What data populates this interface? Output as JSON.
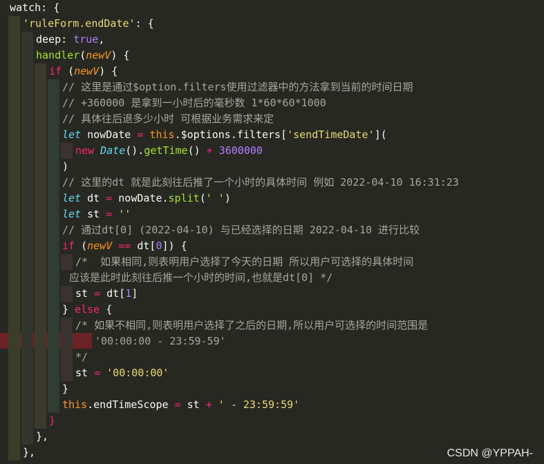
{
  "lines": [
    {
      "indent": 0,
      "tokens": [
        {
          "t": "watch",
          "c": "plain"
        },
        {
          "t": ": ",
          "c": "plain"
        },
        {
          "t": "{",
          "c": "punc"
        }
      ]
    },
    {
      "indent": 1,
      "tokens": [
        {
          "t": "'ruleForm.endDate'",
          "c": "str"
        },
        {
          "t": ": {",
          "c": "plain"
        }
      ]
    },
    {
      "indent": 2,
      "tokens": [
        {
          "t": "deep",
          "c": "plain"
        },
        {
          "t": ": ",
          "c": "plain"
        },
        {
          "t": "true",
          "c": "bool"
        },
        {
          "t": ",",
          "c": "plain"
        }
      ]
    },
    {
      "indent": 2,
      "tokens": [
        {
          "t": "handler",
          "c": "fn"
        },
        {
          "t": "(",
          "c": "plain"
        },
        {
          "t": "newV",
          "c": "param"
        },
        {
          "t": ") {",
          "c": "plain"
        }
      ]
    },
    {
      "indent": 3,
      "tokens": [
        {
          "t": "if",
          "c": "kw"
        },
        {
          "t": " (",
          "c": "plain"
        },
        {
          "t": "newV",
          "c": "param"
        },
        {
          "t": ") {",
          "c": "plain"
        }
      ]
    },
    {
      "indent": 4,
      "tokens": [
        {
          "t": "// 这里是通过$option.filters使用过滤器中的方法拿到当前的时间日期",
          "c": "cmt"
        }
      ]
    },
    {
      "indent": 4,
      "tokens": [
        {
          "t": "// +360000 是拿到一小时后的毫秒数 1*60*60*1000",
          "c": "cmt"
        }
      ]
    },
    {
      "indent": 4,
      "tokens": [
        {
          "t": "// 具体往后退多少小时 可根据业务需求来定",
          "c": "cmt"
        }
      ]
    },
    {
      "indent": 4,
      "tokens": [
        {
          "t": "let",
          "c": "kwi"
        },
        {
          "t": " nowDate ",
          "c": "plain"
        },
        {
          "t": "=",
          "c": "kw"
        },
        {
          "t": " ",
          "c": "plain"
        },
        {
          "t": "this",
          "c": "this"
        },
        {
          "t": ".$options.filters[",
          "c": "plain"
        },
        {
          "t": "'sendTimeDate'",
          "c": "str"
        },
        {
          "t": "](",
          "c": "plain"
        }
      ]
    },
    {
      "indent": 5,
      "tokens": [
        {
          "t": "new",
          "c": "kw"
        },
        {
          "t": " ",
          "c": "plain"
        },
        {
          "t": "Date",
          "c": "cls"
        },
        {
          "t": "().",
          "c": "plain"
        },
        {
          "t": "getTime",
          "c": "fn"
        },
        {
          "t": "() ",
          "c": "plain"
        },
        {
          "t": "+",
          "c": "kw"
        },
        {
          "t": " ",
          "c": "plain"
        },
        {
          "t": "3600000",
          "c": "num"
        }
      ]
    },
    {
      "indent": 4,
      "tokens": [
        {
          "t": ")",
          "c": "plain"
        }
      ]
    },
    {
      "indent": 4,
      "tokens": [
        {
          "t": "// 这里的dt 就是此刻往后推了一个小时的具体时间 例如 2022-04-10 16:31:23",
          "c": "cmt"
        }
      ]
    },
    {
      "indent": 4,
      "tokens": [
        {
          "t": "let",
          "c": "kwi"
        },
        {
          "t": " dt ",
          "c": "plain"
        },
        {
          "t": "=",
          "c": "kw"
        },
        {
          "t": " nowDate.",
          "c": "plain"
        },
        {
          "t": "split",
          "c": "fn"
        },
        {
          "t": "(",
          "c": "plain"
        },
        {
          "t": "' '",
          "c": "str"
        },
        {
          "t": ")",
          "c": "plain"
        }
      ]
    },
    {
      "indent": 4,
      "tokens": [
        {
          "t": "let",
          "c": "kwi"
        },
        {
          "t": " st ",
          "c": "plain"
        },
        {
          "t": "=",
          "c": "kw"
        },
        {
          "t": " ",
          "c": "plain"
        },
        {
          "t": "''",
          "c": "str"
        }
      ]
    },
    {
      "indent": 4,
      "tokens": [
        {
          "t": "// 通过dt[0] (2022-04-10) 与已经选择的日期 2022-04-10 进行比较",
          "c": "cmt"
        }
      ]
    },
    {
      "indent": 4,
      "tokens": [
        {
          "t": "if",
          "c": "kw"
        },
        {
          "t": " (",
          "c": "plain"
        },
        {
          "t": "newV",
          "c": "param"
        },
        {
          "t": " ",
          "c": "plain"
        },
        {
          "t": "==",
          "c": "kw"
        },
        {
          "t": " dt[",
          "c": "plain"
        },
        {
          "t": "0",
          "c": "num"
        },
        {
          "t": "]) {",
          "c": "plain"
        }
      ]
    },
    {
      "indent": 5,
      "tokens": [
        {
          "t": "/*  如果相同,则表明用户选择了今天的日期 所以用户可选择的具体时间",
          "c": "cmt"
        }
      ]
    },
    {
      "indent": 4,
      "offset": 10,
      "tokens": [
        {
          "t": "应该是此时此刻往后推一个小时的时间,也就是dt[0] */",
          "c": "cmt"
        }
      ]
    },
    {
      "indent": 5,
      "tokens": [
        {
          "t": "st ",
          "c": "plain"
        },
        {
          "t": "=",
          "c": "kw"
        },
        {
          "t": " dt[",
          "c": "plain"
        },
        {
          "t": "1",
          "c": "num"
        },
        {
          "t": "]",
          "c": "plain"
        }
      ]
    },
    {
      "indent": 4,
      "tokens": [
        {
          "t": "} ",
          "c": "plain"
        },
        {
          "t": "else",
          "c": "kw"
        },
        {
          "t": " {",
          "c": "plain"
        }
      ]
    },
    {
      "indent": 5,
      "tokens": [
        {
          "t": "/* 如果不相同,则表明用户选择了之后的日期,所以用户可选择的时间范围是",
          "c": "cmt"
        }
      ]
    },
    {
      "indent": 5,
      "offset": 28,
      "tokens": [
        {
          "t": "'00:00:00 - 23:59-59'",
          "c": "cmt"
        }
      ]
    },
    {
      "indent": 5,
      "tokens": [
        {
          "t": "*/",
          "c": "cmt"
        }
      ]
    },
    {
      "indent": 5,
      "tokens": [
        {
          "t": "st ",
          "c": "plain"
        },
        {
          "t": "=",
          "c": "kw"
        },
        {
          "t": " ",
          "c": "plain"
        },
        {
          "t": "'00:00:00'",
          "c": "str"
        }
      ]
    },
    {
      "indent": 4,
      "tokens": [
        {
          "t": "}",
          "c": "plain"
        }
      ]
    },
    {
      "indent": 4,
      "tokens": [
        {
          "t": "this",
          "c": "this"
        },
        {
          "t": ".endTimeScope ",
          "c": "plain"
        },
        {
          "t": "=",
          "c": "kw"
        },
        {
          "t": " st ",
          "c": "plain"
        },
        {
          "t": "+",
          "c": "kw"
        },
        {
          "t": " ",
          "c": "plain"
        },
        {
          "t": "' - 23:59:59'",
          "c": "str"
        }
      ]
    },
    {
      "indent": 3,
      "tokens": [
        {
          "t": "}",
          "c": "punc2"
        }
      ]
    },
    {
      "indent": 2,
      "tokens": [
        {
          "t": "},",
          "c": "plain"
        }
      ]
    },
    {
      "indent": 1,
      "tokens": [
        {
          "t": "},",
          "c": "plain"
        }
      ]
    }
  ],
  "guide_colors": [
    "#3a3d28",
    "#33362c",
    "#3b3a2d",
    "#2f3d33",
    "#3a3330",
    "#2e3b3f"
  ],
  "watermark": "CSDN @YPPAH-"
}
